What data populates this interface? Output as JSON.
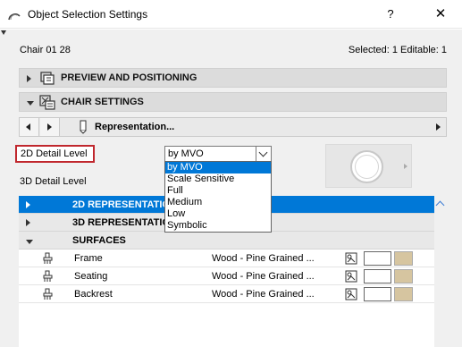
{
  "window": {
    "title": "Object Selection Settings",
    "help_label": "?",
    "close_label": "✕"
  },
  "header": {
    "object_name": "Chair 01 28",
    "selection_info": "Selected: 1 Editable: 1"
  },
  "sections": {
    "preview_positioning": {
      "label": "PREVIEW AND POSITIONING",
      "expanded": false,
      "icon": "preview-icon"
    },
    "chair_settings": {
      "label": "CHAIR SETTINGS",
      "expanded": true,
      "icon": "chair-settings-icon"
    }
  },
  "representation_bar": {
    "label": "Representation...",
    "icon": "pencil-icon"
  },
  "detail": {
    "label_2d": "2D Detail Level",
    "label_3d": "3D Detail Level",
    "selected_value": "by MVO",
    "options": [
      "by MVO",
      "Scale Sensitive",
      "Full",
      "Medium",
      "Low",
      "Symbolic"
    ]
  },
  "tree": {
    "groups": [
      {
        "label": "2D REPRESENTATION",
        "expanded": false,
        "selected": true
      },
      {
        "label": "3D REPRESENTATION",
        "expanded": false,
        "selected": false
      },
      {
        "label": "SURFACES",
        "expanded": true,
        "selected": false
      }
    ],
    "surfaces": [
      {
        "name": "Frame",
        "material": "Wood - Pine Grained ..."
      },
      {
        "name": "Seating",
        "material": "Wood - Pine Grained ..."
      },
      {
        "name": "Backrest",
        "material": "Wood - Pine Grained ..."
      }
    ]
  },
  "colors": {
    "accent": "#0078d7",
    "highlight_border": "#c0272d",
    "wood_swatch": "#d6c5a0"
  }
}
